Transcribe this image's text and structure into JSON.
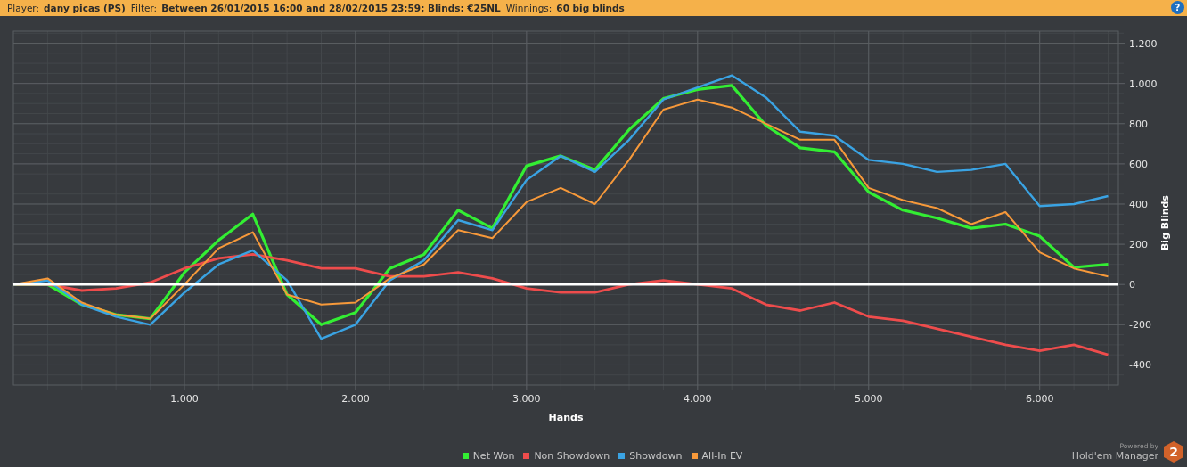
{
  "filter_bar": {
    "fields": [
      {
        "label": "Player:",
        "value": "dany picas (PS)"
      },
      {
        "label": "Filter:",
        "value": "Between 26/01/2015 16:00 and 28/02/2015 23:59; Blinds: €25NL"
      },
      {
        "label": "Winnings:",
        "value": "60 big blinds"
      }
    ],
    "help": "?"
  },
  "graph": {
    "chart_data": {
      "type": "line",
      "grid": true,
      "xlabel": "Hands",
      "ylabel": "Big Blinds",
      "xlim": [
        0,
        6460
      ],
      "ylim": [
        -500,
        1260
      ],
      "xticks": [
        {
          "value": 1000,
          "label": "1.000"
        },
        {
          "value": 2000,
          "label": "2.000"
        },
        {
          "value": 3000,
          "label": "3.000"
        },
        {
          "value": 4000,
          "label": "4.000"
        },
        {
          "value": 5000,
          "label": "5.000"
        },
        {
          "value": 6000,
          "label": "6.000"
        }
      ],
      "yticks": [
        {
          "value": -400,
          "label": "-400"
        },
        {
          "value": -200,
          "label": "-200"
        },
        {
          "value": 0,
          "label": "0"
        },
        {
          "value": 200,
          "label": "200"
        },
        {
          "value": 400,
          "label": "400"
        },
        {
          "value": 600,
          "label": "600"
        },
        {
          "value": 800,
          "label": "800"
        },
        {
          "value": 1000,
          "label": "1.000"
        },
        {
          "value": 1200,
          "label": "1.200"
        }
      ],
      "x": [
        0,
        200,
        400,
        600,
        800,
        1000,
        1200,
        1400,
        1600,
        1800,
        2000,
        2200,
        2400,
        2600,
        2800,
        3000,
        3200,
        3400,
        3600,
        3800,
        4000,
        4200,
        4400,
        4600,
        4800,
        5000,
        5200,
        5400,
        5600,
        5800,
        6000,
        6200,
        6400
      ],
      "series": [
        {
          "name": "Net Won",
          "color": "#33ee33",
          "values": [
            0,
            0,
            -100,
            -150,
            -170,
            60,
            220,
            350,
            -50,
            -200,
            -140,
            80,
            150,
            370,
            280,
            590,
            640,
            570,
            770,
            925,
            970,
            990,
            790,
            680,
            660,
            460,
            370,
            330,
            280,
            300,
            240,
            85,
            100
          ]
        },
        {
          "name": "Non Showdown",
          "color": "#ee4c4c",
          "values": [
            0,
            0,
            -30,
            -20,
            10,
            80,
            130,
            150,
            120,
            80,
            80,
            40,
            40,
            60,
            30,
            -20,
            -40,
            -40,
            0,
            20,
            0,
            -20,
            -100,
            -130,
            -90,
            -160,
            -180,
            -220,
            -260,
            -300,
            -330,
            -300,
            -350
          ]
        },
        {
          "name": "Showdown",
          "color": "#3aa3e3",
          "values": [
            0,
            20,
            -100,
            -160,
            -200,
            -40,
            100,
            170,
            20,
            -270,
            -200,
            20,
            120,
            320,
            270,
            520,
            640,
            560,
            720,
            920,
            980,
            1040,
            930,
            760,
            740,
            620,
            600,
            560,
            570,
            600,
            390,
            400,
            440
          ]
        },
        {
          "name": "All-In EV",
          "color": "#f7993a",
          "values": [
            0,
            30,
            -90,
            -150,
            -170,
            0,
            180,
            260,
            -50,
            -100,
            -90,
            30,
            100,
            270,
            230,
            410,
            480,
            400,
            620,
            870,
            920,
            880,
            800,
            720,
            720,
            480,
            420,
            380,
            300,
            360,
            160,
            80,
            40
          ]
        }
      ]
    }
  },
  "branding": {
    "caption": "Powered by",
    "product": "Hold'em Manager",
    "badge": "2"
  }
}
